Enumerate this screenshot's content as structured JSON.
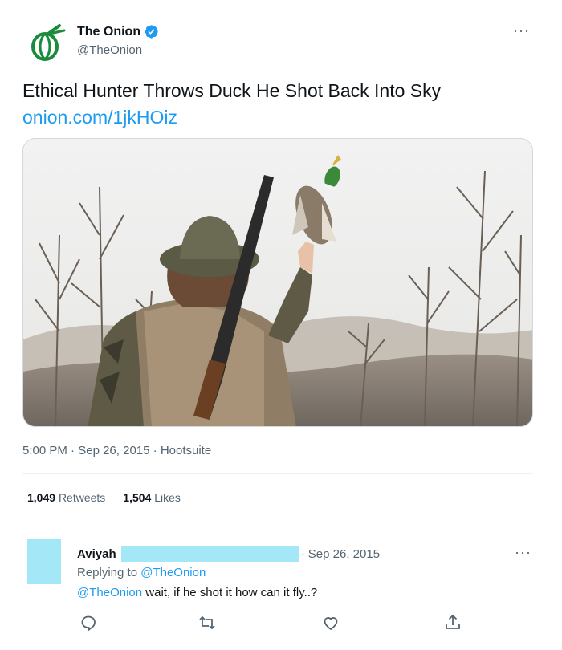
{
  "header": {
    "display_name": "The Onion",
    "handle": "@TheOnion",
    "more_label": "···",
    "avatar_icon": "onion-logo-icon",
    "verified_icon": "verified-badge-icon",
    "brand_color": "#1a8a3b"
  },
  "tweet": {
    "text": "Ethical Hunter Throws Duck He Shot Back Into Sky",
    "link": "onion.com/1jkHOiz",
    "time": "5:00 PM",
    "date": "Sep 26, 2015",
    "source": "Hootsuite"
  },
  "stats": {
    "retweets_count": "1,049",
    "retweets_label": "Retweets",
    "likes_count": "1,504",
    "likes_label": "Likes"
  },
  "reply": {
    "name": "Aviyah",
    "date": "· Sep 26, 2015",
    "more_label": "···",
    "replying_prefix": "Replying to",
    "replying_to": "@TheOnion",
    "mention": "@TheOnion",
    "text": " wait, if he shot it how can it fly..?",
    "redaction_color": "#a4e8f7",
    "actions": [
      "reply-icon",
      "retweet-icon",
      "like-icon",
      "share-icon"
    ]
  },
  "colors": {
    "link": "#1d9bf0",
    "secondary_text": "#536471"
  }
}
